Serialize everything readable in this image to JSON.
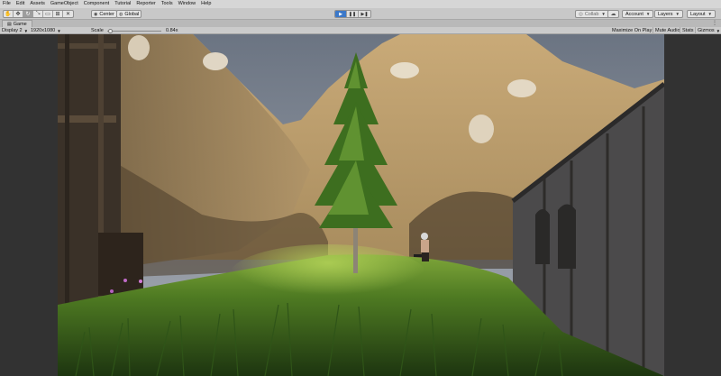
{
  "menubar": {
    "items": [
      "File",
      "Edit",
      "Assets",
      "GameObject",
      "Component",
      "Tutorial",
      "Reporter",
      "Tools",
      "Window",
      "Help"
    ]
  },
  "toolbar": {
    "transform_tools": [
      "hand-icon",
      "move-icon",
      "rotate-icon",
      "scale-icon",
      "rect-icon",
      "transform-icon",
      "custom-tool-icon"
    ],
    "pivot_label": "Center",
    "space_label": "Global",
    "play_controls": [
      "play-icon",
      "pause-icon",
      "step-icon"
    ],
    "collab_label": "Collab",
    "account_label": "Account",
    "layers_label": "Layers",
    "layout_label": "Layout",
    "accent_color": "#3b78c9"
  },
  "game_tab": {
    "title": "Game"
  },
  "game_toolbar": {
    "display": "Display 2",
    "resolution": "1920x1080",
    "scale_label": "Scale",
    "scale_value": "0.84x",
    "scale_fraction": 0.05,
    "maximize_label": "Maximize On Play",
    "mute_label": "Mute Audio",
    "stats_label": "Stats",
    "gizmos_label": "Gizmos"
  }
}
